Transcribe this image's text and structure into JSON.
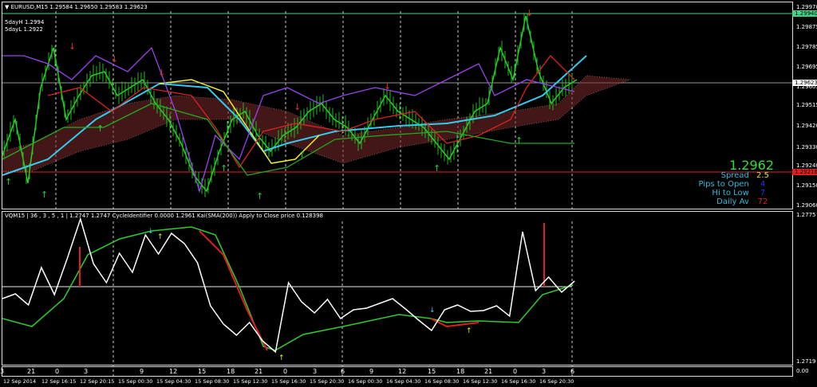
{
  "header": {
    "symbol_line": "EURUSD,M15  1.29584 1.29650 1.29583 1.29623",
    "five_day_high": "5dayH 1.2994",
    "five_day_low": "5dayL 1.2922"
  },
  "price_axis": [
    "1.29970",
    "1.29875",
    "1.29785",
    "1.29695",
    "1.29605",
    "1.29515",
    "1.29420",
    "1.29330",
    "1.29240",
    "1.29150",
    "1.29060"
  ],
  "price_markers": {
    "high_line": "1.29940",
    "current": "1.29623",
    "low_line": "1.29216"
  },
  "info_panel": {
    "price": "1.2962",
    "spread_label": "Spread",
    "spread": "2.5",
    "pips_to_open_label": "Pips to Open",
    "pips_to_open": "4",
    "hi_to_low_label": "Hi to Low",
    "hi_to_low": "7",
    "daily_av_label": "Daily Av",
    "daily_av": "72"
  },
  "indicator": {
    "header": "VQM15 | 36 , 3 , 5 , 1 | 1.2747 1.2747  CycleIdentifier 0.0000 1.2961  Kai(SMA(200)) Apply to Close price 0.128398",
    "axis_top": "1.2775",
    "axis_bottom": "1.2719",
    "axis_zero": "0.00"
  },
  "time_axis": {
    "hours": [
      "3",
      "21",
      "0",
      "3",
      "9",
      "12",
      "15",
      "18",
      "21",
      "0",
      "3",
      "6",
      "9",
      "12",
      "15",
      "18",
      "21",
      "0",
      "3",
      "6"
    ],
    "dates": [
      "12 Sep 2014",
      "12 Sep 16:15",
      "12 Sep 20:15",
      "15 Sep 00:30",
      "15 Sep 04:30",
      "15 Sep 08:30",
      "15 Sep 12:30",
      "15 Sep 16:30",
      "15 Sep 20:30",
      "16 Sep 00:30",
      "16 Sep 04:30",
      "16 Sep 08:30",
      "16 Sep 12:30",
      "16 Sep 16:30",
      "16 Sep 20:30"
    ]
  },
  "colors": {
    "high": "#3fd68a",
    "low": "#e02020",
    "up_arrow": "#2ecc2e",
    "down_arrow": "#e03030",
    "cyan": "#33ccee",
    "purple": "#9944ee",
    "yellow": "#eeee33"
  }
}
